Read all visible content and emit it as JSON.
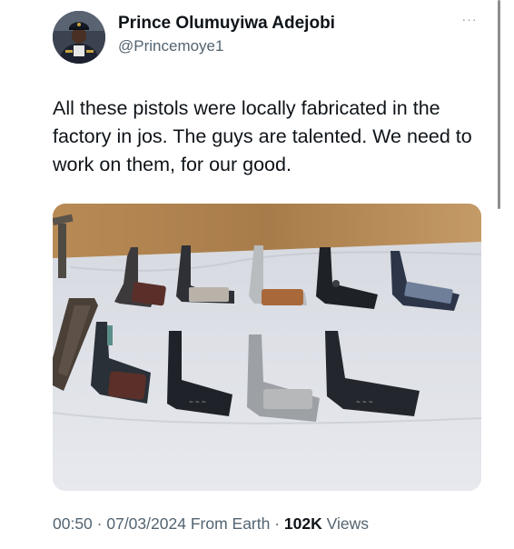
{
  "author": {
    "display_name": "Prince Olumuyiwa Adejobi",
    "handle": "@Princemoye1",
    "avatar_icon": "police-officer-avatar"
  },
  "header": {
    "more_icon_glyph": "···"
  },
  "tweet": {
    "text": "All these pistols were locally fabricated in the factory in jos. The guys are talented. We need to work on them, for our good."
  },
  "media": {
    "image_subject": "pistols-on-white-cloth"
  },
  "meta": {
    "time": "00:50",
    "separator": " · ",
    "date": "07/03/2024",
    "source": "From Earth",
    "views_count": "102K",
    "views_label": "Views"
  },
  "colors": {
    "text_primary": "#0f1419",
    "text_secondary": "#536471"
  }
}
